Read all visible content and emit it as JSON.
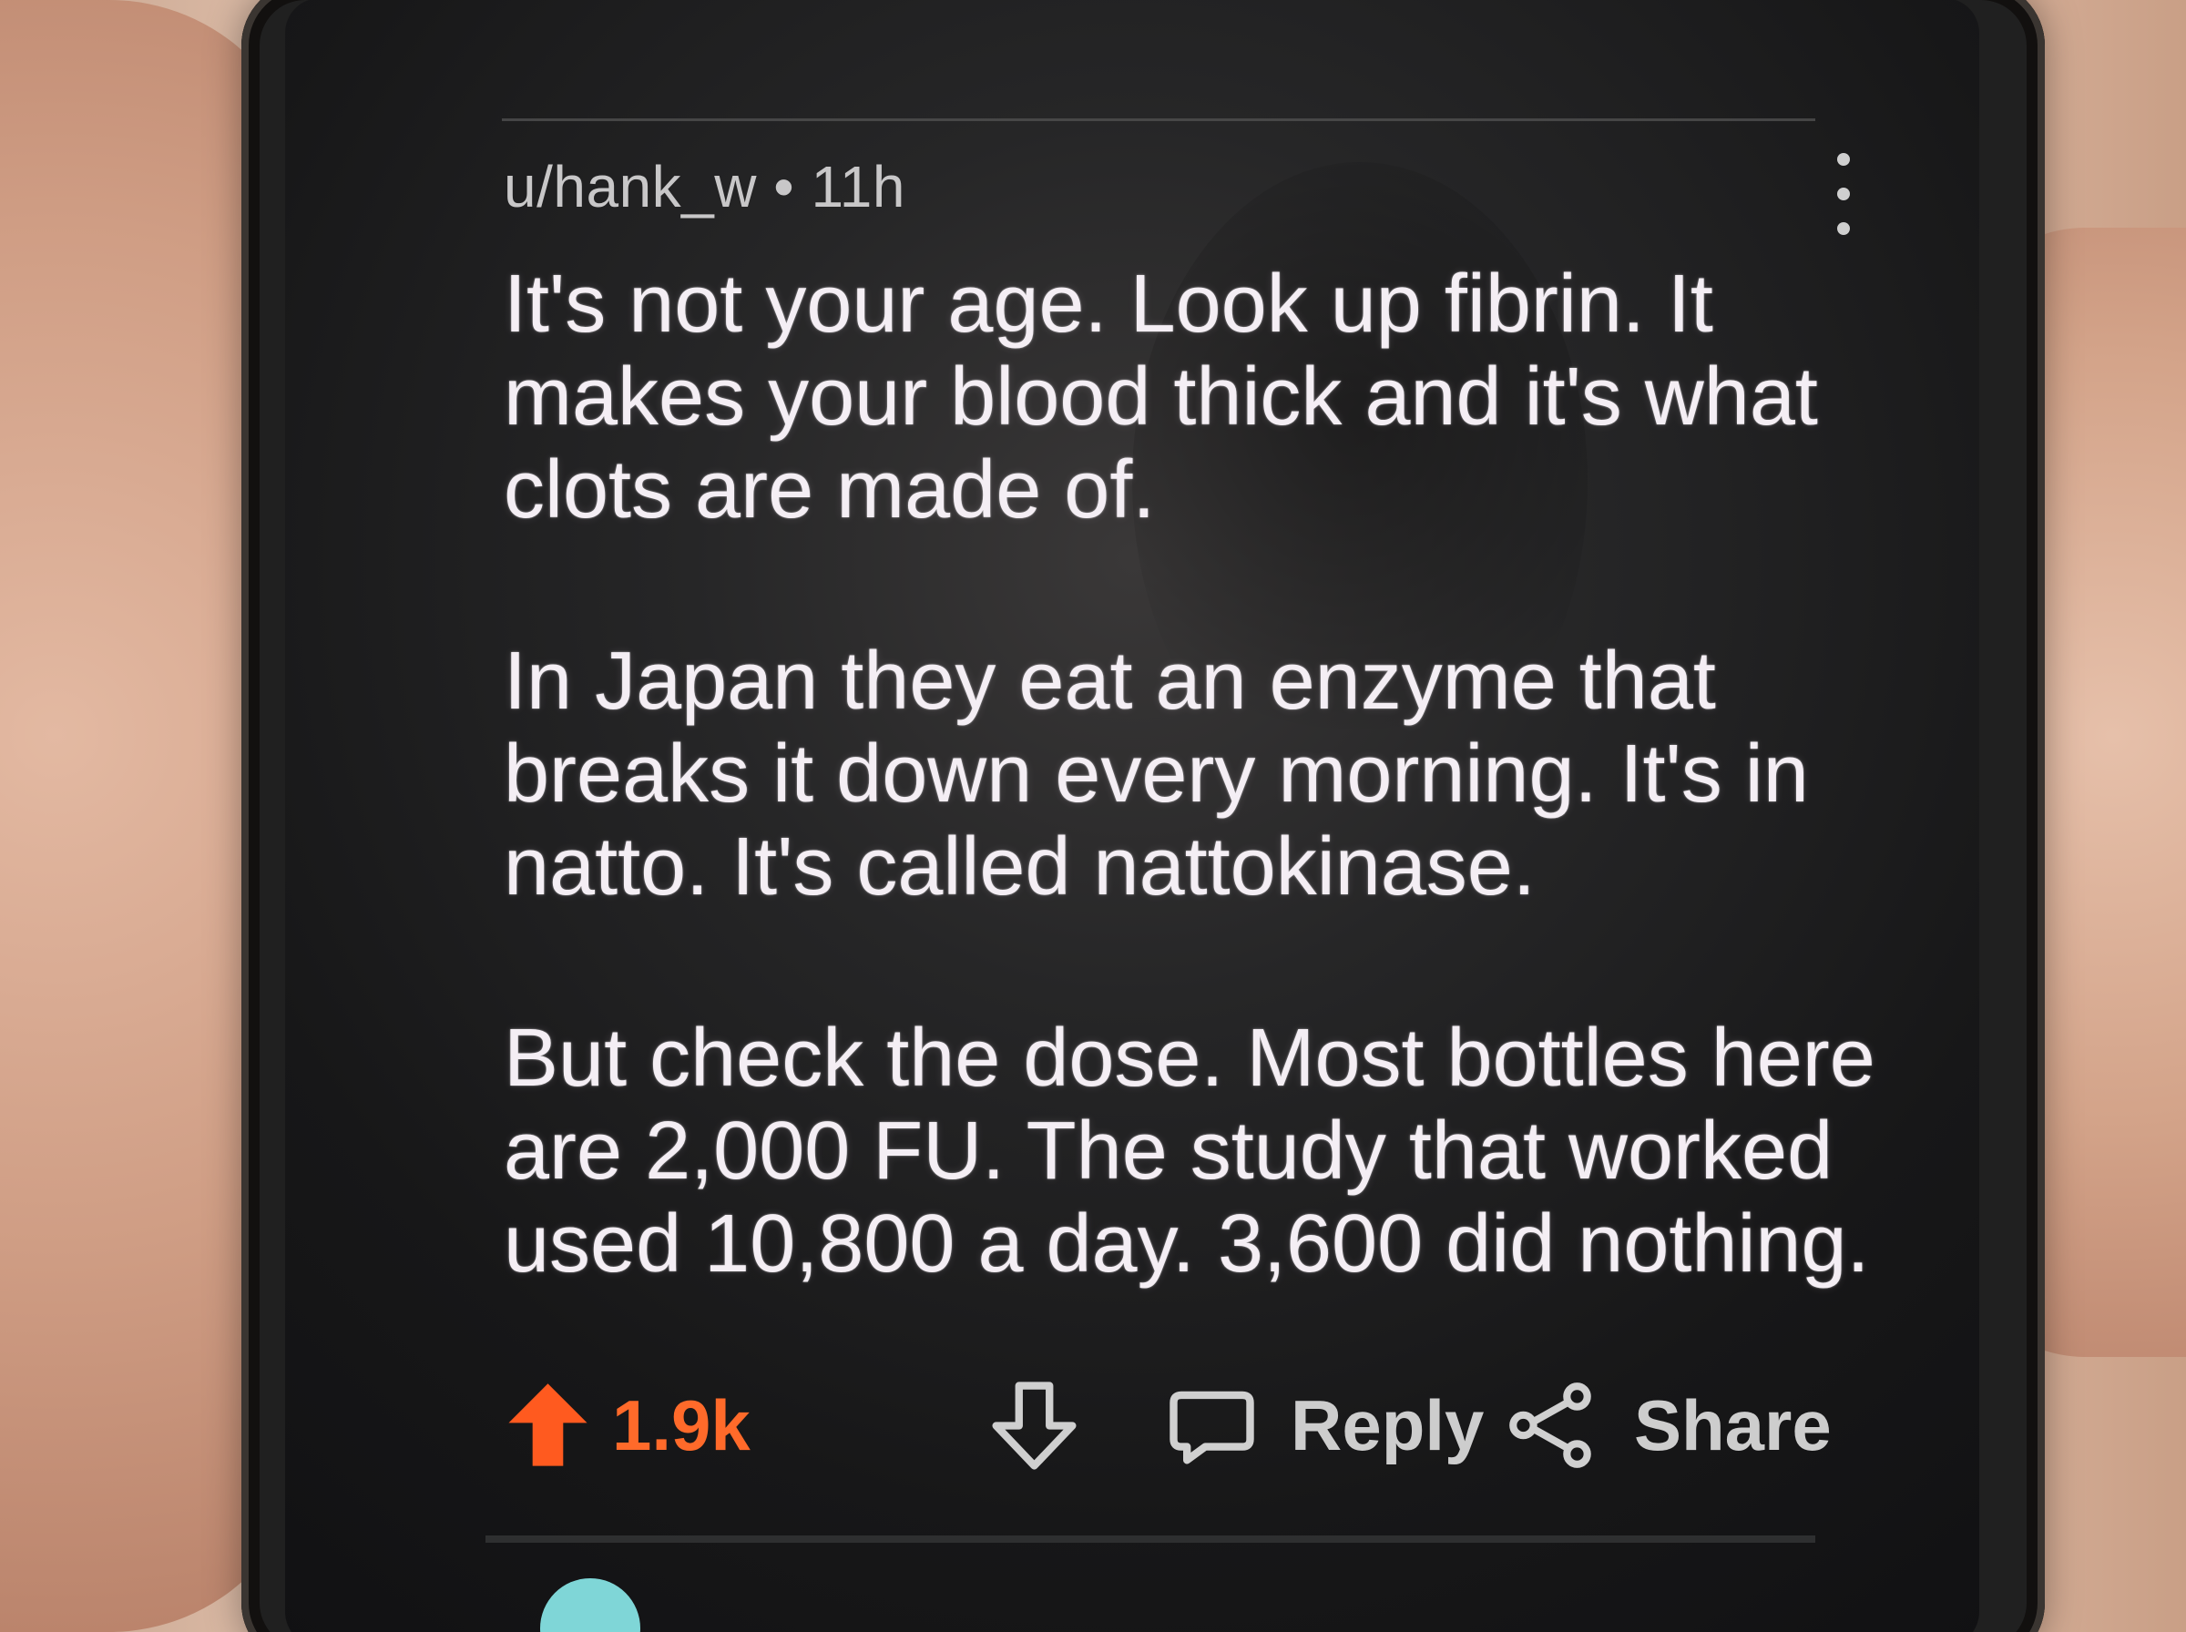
{
  "comment": {
    "username": "u/hank_w",
    "separator": "•",
    "time": "11h",
    "menu_icon": "more-vertical-icon",
    "paragraphs": [
      "It's not your age. Look up fibrin. It makes your blood thick and it's what clots are made of.",
      "In Japan they eat an enzyme that breaks it down every morning. It's in natto. It's called nattokinase.",
      "But check the dose. Most bottles here are 2,000 FU. The study that worked used 10,800 a day. 3,600 did nothing."
    ],
    "actions": {
      "upvote_icon": "upvote-arrow-icon",
      "score": "1.9k",
      "downvote_icon": "downvote-arrow-icon",
      "reply_icon": "comment-bubble-icon",
      "reply_label": "Reply",
      "share_icon": "share-icon",
      "share_label": "Share"
    },
    "colors": {
      "background": "#171718",
      "text": "#f4eef4",
      "meta": "#c8c7c8",
      "accent": "#ff6a2a",
      "action_text": "#cdcdcd"
    }
  }
}
